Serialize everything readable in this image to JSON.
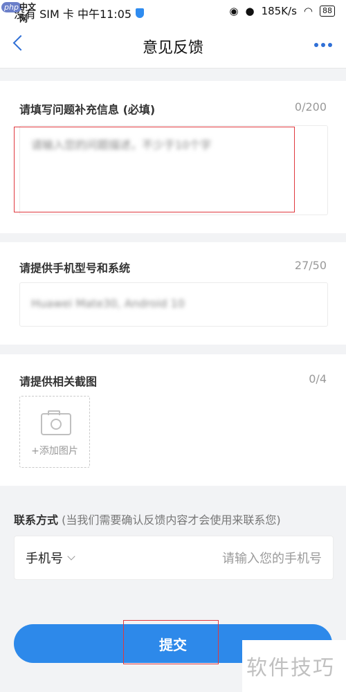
{
  "logo": {
    "badge": "php",
    "text": "中文网"
  },
  "status_bar": {
    "carrier_time": "没有 SIM 卡 中午11:05",
    "net_speed": "185K/s",
    "battery": "88",
    "icons": [
      "shield-icon",
      "eye-icon",
      "location-icon",
      "wifi-icon",
      "battery-icon"
    ]
  },
  "nav": {
    "title": "意见反馈",
    "back_icon": "chevron-left-icon",
    "more_icon": "more-dots-icon"
  },
  "problem": {
    "label": "请填写问题补充信息 (必填)",
    "count": "0/200",
    "placeholder": "请输入您的问题描述，不少于10个字"
  },
  "device": {
    "label": "请提供手机型号和系统",
    "count": "27/50",
    "value": "Huawei Mate30, Android 10"
  },
  "screenshots": {
    "label": "请提供相关截图",
    "count": "0/4",
    "add_label": "+添加图片"
  },
  "contact": {
    "label": "联系方式",
    "hint": "(当我们需要确认反馈内容才会使用来联系您)",
    "type": "手机号",
    "placeholder": "请输入您的手机号"
  },
  "submit": {
    "label": "提交"
  },
  "watermark": "软件技巧",
  "colors": {
    "accent": "#2d89ea",
    "highlight": "#e0383e"
  }
}
